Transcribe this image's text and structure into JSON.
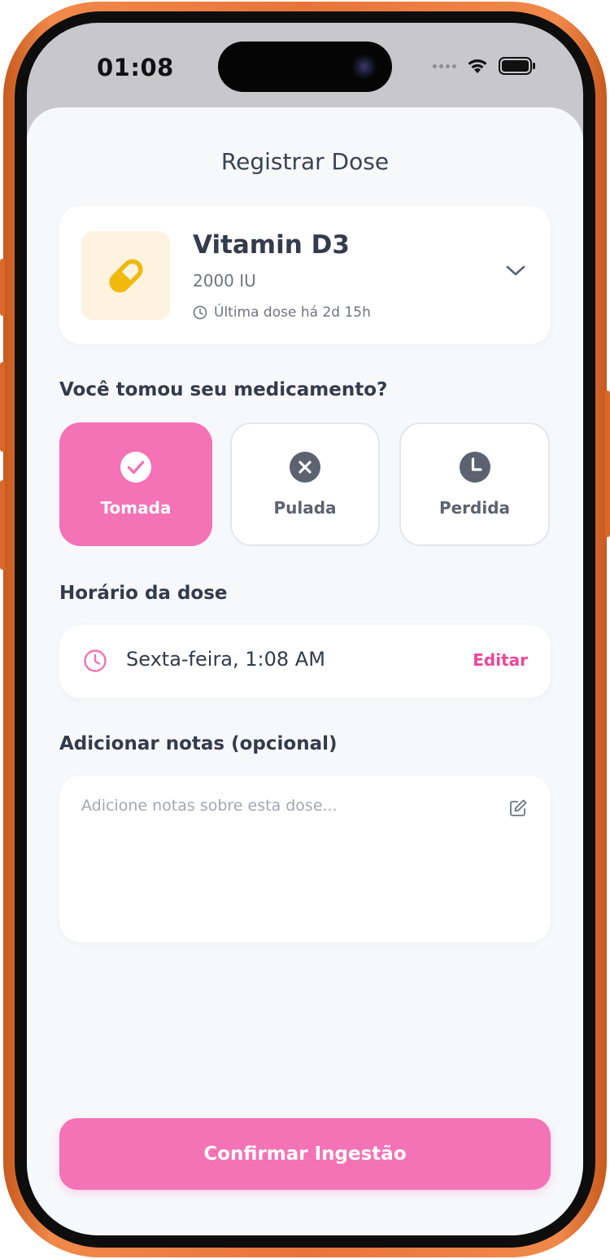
{
  "status_bar": {
    "time": "01:08",
    "icons": [
      "cellular-dots-icon",
      "wifi-icon",
      "battery-icon"
    ]
  },
  "sheet": {
    "title": "Registrar Dose"
  },
  "medication": {
    "icon": "pill-icon",
    "name": "Vitamin D3",
    "dose": "2000 IU",
    "last_dose": "Última dose há 2d 15h"
  },
  "intake_question": {
    "label": "Você tomou seu medicamento?",
    "options": [
      {
        "label": "Tomada",
        "icon": "check-circle-icon",
        "selected": true
      },
      {
        "label": "Pulada",
        "icon": "x-circle-icon",
        "selected": false
      },
      {
        "label": "Perdida",
        "icon": "clock-circle-icon",
        "selected": false
      }
    ]
  },
  "dose_time": {
    "label": "Horário da dose",
    "value": "Sexta-feira, 1:08 AM",
    "edit_label": "Editar"
  },
  "notes": {
    "label": "Adicionar notas (opcional)",
    "value": "",
    "placeholder": "Adicione notas sobre esta dose..."
  },
  "confirm_button": {
    "label": "Confirmar Ingestão"
  },
  "colors": {
    "accent": "#f472b6",
    "accent_text": "#ec4899",
    "pill_bg": "#fdf3df",
    "pill_icon": "#f0b90b",
    "text_dark": "#333b4d",
    "frame": "#e8743a"
  }
}
